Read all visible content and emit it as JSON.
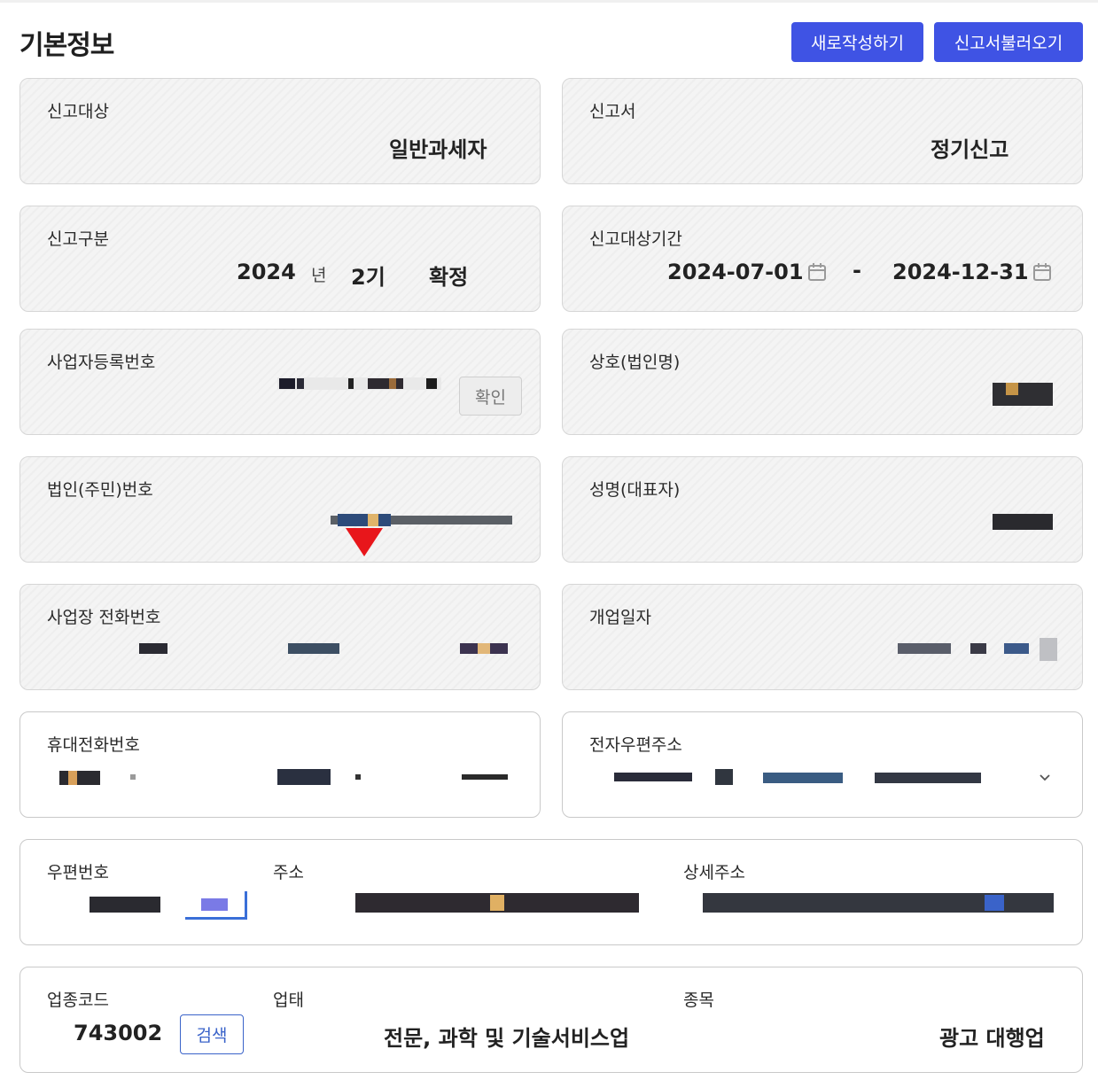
{
  "header": {
    "title": "기본정보",
    "new_button": "새로작성하기",
    "load_button": "신고서불러오기"
  },
  "fields": {
    "report_target": {
      "label": "신고대상",
      "value": "일반과세자"
    },
    "report_type": {
      "label": "신고서",
      "value": "정기신고"
    },
    "report_category": {
      "label": "신고구분",
      "year": "2024",
      "year_unit": "년",
      "term": "2기",
      "status": "확정"
    },
    "report_period": {
      "label": "신고대상기간",
      "start": "2024-07-01",
      "separator": "-",
      "end": "2024-12-31"
    },
    "business_reg_no": {
      "label": "사업자등록번호",
      "confirm_button": "확인"
    },
    "company_name": {
      "label": "상호(법인명)"
    },
    "corp_id_no": {
      "label": "법인(주민)번호"
    },
    "representative": {
      "label": "성명(대표자)"
    },
    "business_phone": {
      "label": "사업장 전화번호"
    },
    "opening_date": {
      "label": "개업일자"
    },
    "mobile_phone": {
      "label": "휴대전화번호"
    },
    "email": {
      "label": "전자우편주소"
    },
    "address": {
      "zip_label": "우편번호",
      "addr_label": "주소",
      "detail_label": "상세주소"
    },
    "industry": {
      "code_label": "업종코드",
      "code": "743002",
      "search_button": "검색",
      "type_label": "업태",
      "type_value": "전문, 과학 및 기술서비스업",
      "item_label": "종목",
      "item_value": "광고 대행업"
    }
  },
  "icons": {
    "calendar": "calendar-icon",
    "dropdown": "chevron-down-icon",
    "marker": "red-triangle-marker"
  },
  "colors": {
    "primary": "#3f53e4",
    "search_border": "#3a63c9",
    "marker": "#e8161b"
  }
}
